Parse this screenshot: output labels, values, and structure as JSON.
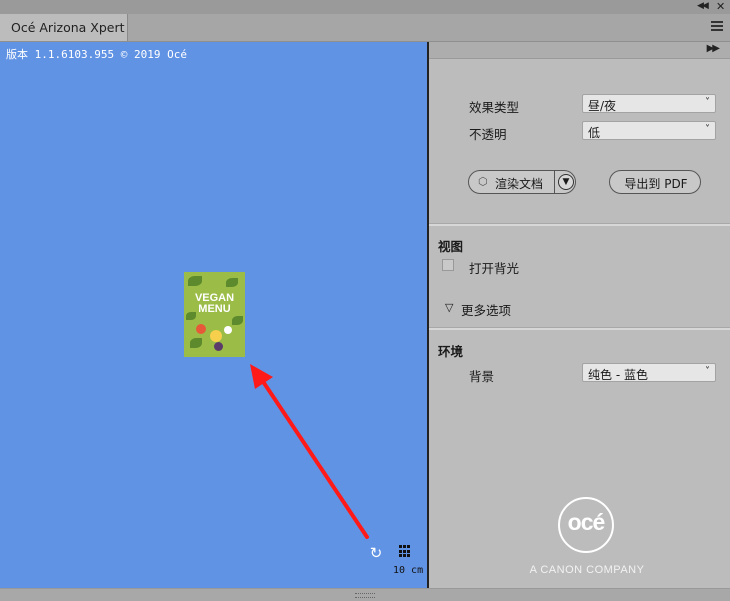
{
  "window": {
    "tab_title": "Océ Arizona Xpert"
  },
  "canvas": {
    "version_text": "版本 1.1.6103.955 © 2019 Océ",
    "thumbnail": {
      "line1": "VEGAN",
      "line2": "MENU"
    },
    "scale_label": "10 cm",
    "background_color": "#6193e4",
    "rotate_icon": "rotate-icon",
    "grid_icon": "grid-icon"
  },
  "panel": {
    "effect_type_label": "效果类型",
    "effect_type_value": "昼/夜",
    "opacity_label": "不透明",
    "opacity_value": "低",
    "render_button_label": "渲染文档",
    "export_button_label": "导出到 PDF",
    "view_section_title": "视图",
    "backlight_label": "打开背光",
    "more_options_label": "更多选项",
    "env_section_title": "环境",
    "background_label": "背景",
    "background_value": "纯色 - 蓝色"
  },
  "brand": {
    "logo_text": "océ",
    "tagline": "A CANON COMPANY"
  },
  "annotation": {
    "arrow_color": "#ff1a1a"
  }
}
